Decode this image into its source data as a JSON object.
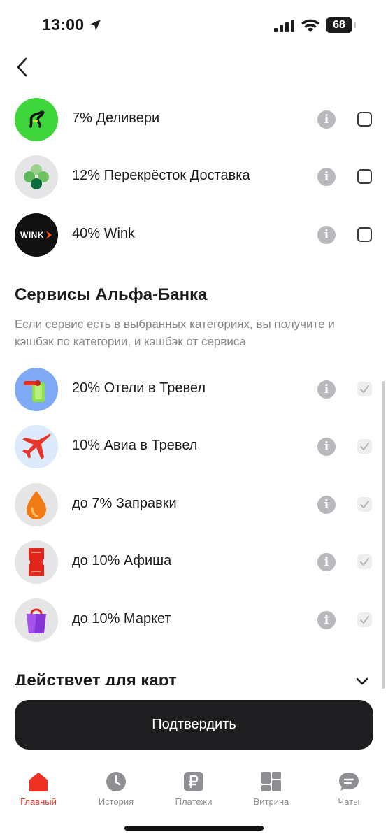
{
  "status": {
    "time": "13:00",
    "battery": "68"
  },
  "offers": [
    {
      "label": "7% Деливери",
      "logo": "delivery-logo",
      "checked": false
    },
    {
      "label": "12% Перекрёсток Доставка",
      "logo": "perekrestok-logo",
      "checked": false
    },
    {
      "label": "40% Wink",
      "logo": "wink-logo",
      "logo_text": "WINK",
      "checked": false
    }
  ],
  "alfa_section": {
    "title": "Сервисы Альфа-Банка",
    "description": "Если сервис есть в выбранных категориях, вы получите и кэшбэк по категории, и кэшбэк от сервиса",
    "items": [
      {
        "label": "20% Отели в Тревел",
        "logo": "hotel-door-icon",
        "checked": true
      },
      {
        "label": "10% Авиа в Тревел",
        "logo": "airplane-icon",
        "checked": true
      },
      {
        "label": "до 7% Заправки",
        "logo": "fuel-drop-icon",
        "checked": true
      },
      {
        "label": "до 10% Афиша",
        "logo": "ticket-icon",
        "checked": true
      },
      {
        "label": "до 10% Маркет",
        "logo": "shopping-bag-icon",
        "checked": true
      }
    ]
  },
  "cards_section": {
    "title": "Действует для карт"
  },
  "confirm_label": "Подтвердить",
  "tabs": [
    {
      "label": "Главный",
      "icon": "home-icon",
      "active": true
    },
    {
      "label": "История",
      "icon": "clock-icon",
      "active": false
    },
    {
      "label": "Платежи",
      "icon": "ruble-icon",
      "active": false
    },
    {
      "label": "Витрина",
      "icon": "showcase-icon",
      "active": false
    },
    {
      "label": "Чаты",
      "icon": "chat-icon",
      "active": false
    }
  ],
  "colors": {
    "accent": "#ef3124",
    "delivery_green": "#3fd63b",
    "button_dark": "#1e1e20"
  }
}
